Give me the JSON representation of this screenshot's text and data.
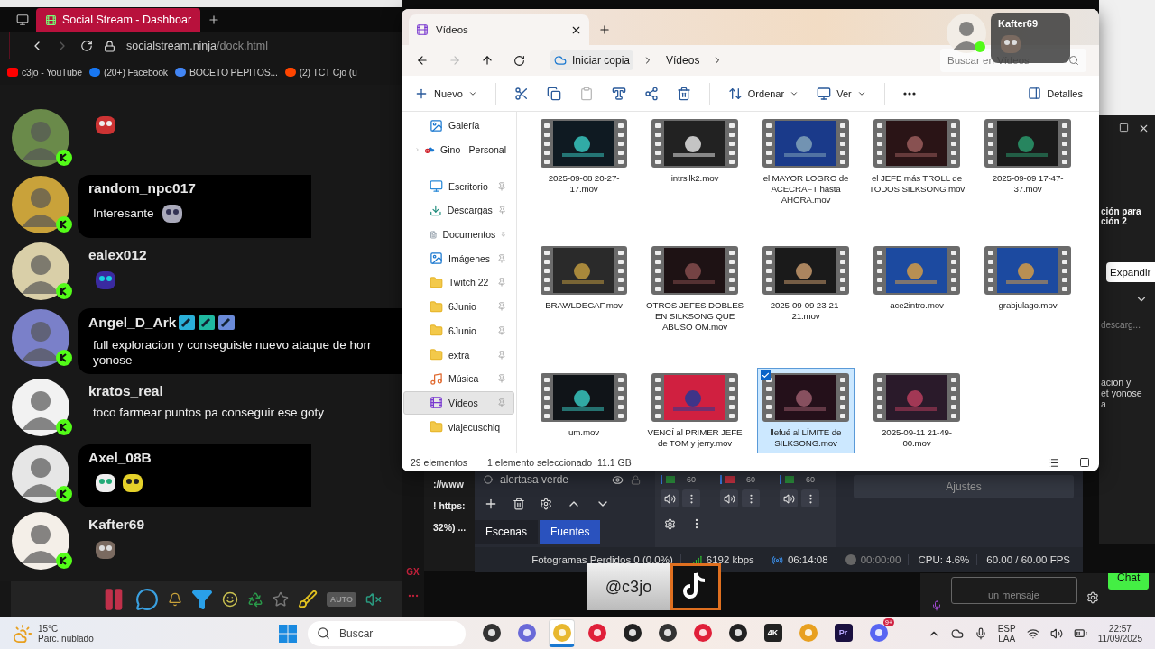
{
  "browser": {
    "tab_title": "Social Stream - Dashboar",
    "url_host": "socialstream.ninja",
    "url_path": "/dock.html",
    "bookmarks": [
      {
        "kind": "youtube",
        "label": "c3jo - YouTube"
      },
      {
        "kind": "facebook",
        "label": "(20+) Facebook"
      },
      {
        "kind": "google",
        "label": "BOCETO PEPITOS..."
      },
      {
        "kind": "reddit",
        "label": "(2) TCT Cjo (u"
      }
    ]
  },
  "chat": [
    {
      "highlighted": false,
      "emotes": [
        {
          "kind": "figure"
        }
      ]
    },
    {
      "name": "random_npc017",
      "highlighted": true,
      "text": "Interesante",
      "emotes": [
        {
          "kind": "eyes"
        }
      ]
    },
    {
      "name": "ealex012",
      "highlighted": false,
      "emotes": [
        {
          "kind": "sticker"
        }
      ]
    },
    {
      "name": "Angel_D_Ark",
      "highlighted": true,
      "badges": [
        {
          "kind": "hammer"
        },
        {
          "kind": "tag"
        },
        {
          "kind": "gem"
        }
      ],
      "text": "full exploracion y conseguiste nuevo ataque de horr\nyonose"
    },
    {
      "name": "kratos_real",
      "highlighted": false,
      "text": "toco farmear puntos pa conseguir ese goty"
    },
    {
      "name": "Axel_08B",
      "highlighted": true,
      "emotes": [
        {
          "kind": "skull"
        },
        {
          "kind": "blob"
        }
      ]
    },
    {
      "name": "Kafter69",
      "highlighted": false
    }
  ],
  "chat_toolbar": [
    {
      "kind": "pause"
    },
    {
      "kind": "chat"
    },
    {
      "kind": "bell"
    },
    {
      "kind": "filter"
    },
    {
      "kind": "smile"
    },
    {
      "kind": "recycle"
    },
    {
      "kind": "star"
    },
    {
      "kind": "broom"
    },
    {
      "kind": "auto",
      "label": "AUTO"
    },
    {
      "kind": "mute"
    }
  ],
  "explorer": {
    "tab_title": "Vídeos",
    "breadcrumb": [
      "Iniciar copia",
      "Vídeos"
    ],
    "search_placeholder": "Buscar en Vídeos",
    "toolbar": [
      {
        "kind": "new",
        "label": "Nuevo",
        "disabled": false
      },
      {
        "kind": "cut",
        "disabled": false
      },
      {
        "kind": "copy",
        "disabled": false
      },
      {
        "kind": "paste",
        "disabled": true
      },
      {
        "kind": "rename",
        "disabled": false
      },
      {
        "kind": "share",
        "disabled": false
      },
      {
        "kind": "delete",
        "disabled": false
      },
      {
        "kind": "sort",
        "label": "Ordenar",
        "disabled": false
      },
      {
        "kind": "view",
        "label": "Ver",
        "disabled": false
      },
      {
        "kind": "more",
        "disabled": false
      }
    ],
    "details": "Detalles",
    "sidebar": [
      {
        "kind": "gallery",
        "label": "Galería",
        "pinned": false,
        "selected": false
      },
      {
        "kind": "cloud",
        "label": "Gino - Personal",
        "pinned": false,
        "selected": false
      },
      {
        "kind": "desktop",
        "label": "Escritorio",
        "pinned": true,
        "selected": false
      },
      {
        "kind": "download",
        "label": "Descargas",
        "pinned": true,
        "selected": false
      },
      {
        "kind": "docs",
        "label": "Documentos",
        "pinned": true,
        "selected": false
      },
      {
        "kind": "images",
        "label": "Imágenes",
        "pinned": true,
        "selected": false
      },
      {
        "kind": "folder",
        "label": "Twitch 22",
        "pinned": true,
        "selected": false
      },
      {
        "kind": "folder",
        "label": "6Junio",
        "pinned": true,
        "selected": false
      },
      {
        "kind": "folder",
        "label": "6Junio",
        "pinned": true,
        "selected": false
      },
      {
        "kind": "folder",
        "label": "extra",
        "pinned": true,
        "selected": false
      },
      {
        "kind": "music",
        "label": "Música",
        "pinned": true,
        "selected": false
      },
      {
        "kind": "videos",
        "label": "Vídeos",
        "pinned": true,
        "selected": true
      },
      {
        "kind": "folder",
        "label": "viajecuschiq",
        "pinned": false,
        "selected": false
      }
    ],
    "files": [
      {
        "name": "2025-09-08 20-27-17.mov",
        "selected": false
      },
      {
        "name": "intrsilk2.mov",
        "selected": false
      },
      {
        "name": "el MAYOR LOGRO de ACECRAFT hasta AHORA.mov",
        "selected": false
      },
      {
        "name": "el JEFE más TROLL de TODOS SILKSONG.mov",
        "selected": false
      },
      {
        "name": "2025-09-09 17-47-37.mov",
        "selected": false
      },
      {
        "name": "BRAWLDECAF.mov",
        "selected": false
      },
      {
        "name": "OTROS JEFES DOBLES EN SILKSONG QUE ABUSO OM.mov",
        "selected": false
      },
      {
        "name": "2025-09-09 23-21-21.mov",
        "selected": false
      },
      {
        "name": "ace2intro.mov",
        "selected": false
      },
      {
        "name": "grabjulago.mov",
        "selected": false
      },
      {
        "name": "um.mov",
        "selected": false
      },
      {
        "name": "VENCÍ al PRIMER JEFE de TOM y jerry.mov",
        "selected": false
      },
      {
        "name": "llefué al LÍMITE de SILKSONG.mov",
        "selected": true
      },
      {
        "name": "2025-09-11 21-49-00.mov",
        "selected": false
      }
    ],
    "status": {
      "count": "29 elementos",
      "selection": "1 elemento seleccionado  11.1 GB"
    }
  },
  "notification": {
    "name": "Kafter69"
  },
  "background_fragments": [
    "://www",
    "! https:",
    "32%) ..."
  ],
  "side_window": {
    "kind": "panel"
  },
  "opera_sidebar": {
    "logo": "GX"
  },
  "obs": {
    "source": "alertasa verde",
    "scene_tabs": [
      {
        "label": "Escenas",
        "selected": false
      },
      {
        "label": "Fuentes",
        "selected": true
      }
    ],
    "mixer": [
      {
        "reading": "-60"
      },
      {
        "reading": "-60"
      },
      {
        "reading": "-60"
      }
    ],
    "settings": "Ajustes",
    "status": {
      "dropped": "Fotogramas Perdidos 0 (0.0%)",
      "bitrate": "6192 kbps",
      "stream_time": "06:14:08",
      "record_time": "00:00:00",
      "cpu": "CPU: 4.6%",
      "fps": "60.00 / 60.00 FPS"
    }
  },
  "overlay": {
    "handle": "@c3jo"
  },
  "right_panel": {
    "texts": [
      "ción para",
      "ción 2"
    ],
    "expand": "Expandir",
    "download": "descarg...",
    "message_lines": [
      "acion y",
      "et yonose",
      "a"
    ]
  },
  "chat_panel": {
    "placeholder": "un mensaje",
    "button": "Chat"
  },
  "taskbar": {
    "weather": {
      "temp": "15°C",
      "desc": "Parc. nublado"
    },
    "search": "Buscar",
    "apps": [
      {
        "kind": "taskview",
        "selected": false
      },
      {
        "kind": "copilot",
        "selected": false
      },
      {
        "kind": "files",
        "selected": true
      },
      {
        "kind": "play",
        "selected": false
      },
      {
        "kind": "obs",
        "selected": false
      },
      {
        "kind": "capture",
        "selected": false
      },
      {
        "kind": "opera",
        "selected": false
      },
      {
        "kind": "robot",
        "selected": false
      },
      {
        "kind": "fourk",
        "label": "4K",
        "selected": false
      },
      {
        "kind": "notes",
        "selected": false
      },
      {
        "kind": "premiere",
        "label": "Pr",
        "selected": false
      },
      {
        "kind": "discord",
        "badge": "9+",
        "selected": false
      }
    ],
    "lang": [
      "ESP",
      "LAA"
    ],
    "time": "22:57",
    "date": "11/09/2025"
  }
}
